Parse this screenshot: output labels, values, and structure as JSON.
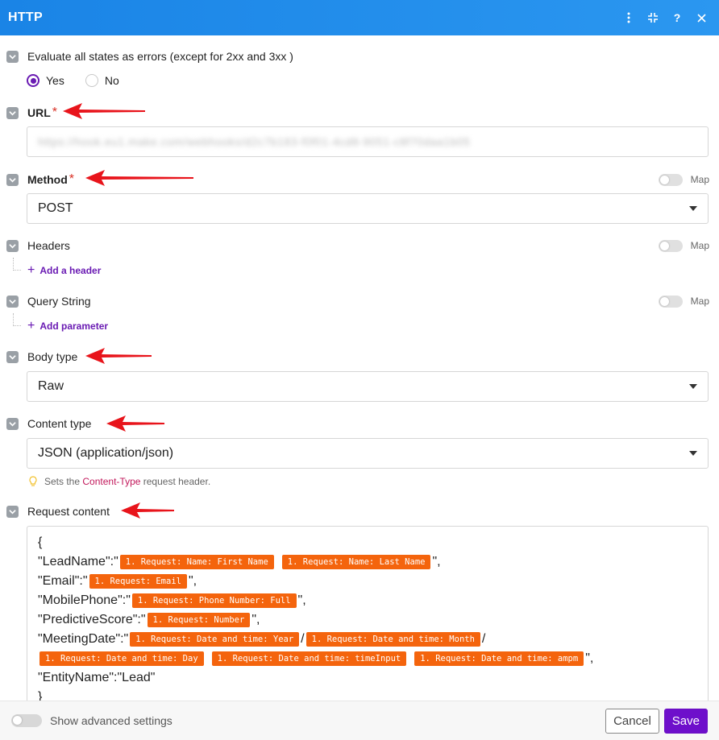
{
  "window": {
    "title": "HTTP",
    "actions": [
      {
        "name": "more-vert-icon",
        "glyph": "⋮"
      },
      {
        "name": "collapse-icon",
        "glyph": "⛶"
      },
      {
        "name": "help-icon",
        "glyph": "?"
      },
      {
        "name": "close-icon",
        "glyph": "✕"
      }
    ]
  },
  "evaluate": {
    "label": "Evaluate all states as errors (except for 2xx and 3xx )",
    "yes": "Yes",
    "no": "No",
    "selected": "Yes"
  },
  "url": {
    "label": "URL",
    "required": "*",
    "value": "https://hook.eu1.make.com/webhooks/d2c7b183-f0f01-4cd8-9051-c8f70daa1b05"
  },
  "method": {
    "label": "Method",
    "required": "*",
    "map": "Map",
    "value": "POST"
  },
  "headers": {
    "label": "Headers",
    "map": "Map",
    "add": "Add a header"
  },
  "query": {
    "label": "Query String",
    "map": "Map",
    "add": "Add parameter"
  },
  "body_type": {
    "label": "Body type",
    "value": "Raw"
  },
  "content_type": {
    "label": "Content type",
    "value": "JSON (application/json)",
    "hint_prefix": "Sets the ",
    "hint_code": "Content-Type",
    "hint_suffix": " request header."
  },
  "request_content": {
    "label": "Request content",
    "lines": {
      "open": "{",
      "lead_key": "\"LeadName\":\"",
      "lead_pill1": "1. Request: Name: First Name",
      "lead_pill2": "1. Request: Name: Last Name",
      "lead_end": "\",",
      "email_key": "\"Email\":\"",
      "email_pill": "1. Request: Email",
      "email_end": "\",",
      "phone_key": "\"MobilePhone\":\"",
      "phone_pill": "1. Request: Phone Number: Full",
      "phone_end": "\",",
      "score_key": "\"PredictiveScore\":\"",
      "score_pill": "1. Request: Number",
      "score_end": "\",",
      "meet_key": "\"MeetingDate\":\"",
      "meet_pill1": "1. Request: Date and time: Year",
      "meet_sep1": "/",
      "meet_pill2": "1. Request: Date and time: Month",
      "meet_sep2": "/",
      "meet_pill3": "1. Request: Date and time: Day",
      "meet_pill4": "1. Request: Date and time: timeInput",
      "meet_pill5": "1. Request: Date and time: ampm",
      "meet_end": "\",",
      "entity": "\"EntityName\":\"Lead\"",
      "close": "}"
    }
  },
  "footer": {
    "advanced": "Show advanced settings",
    "cancel": "Cancel",
    "save": "Save"
  },
  "colors": {
    "header": "#1a84e6",
    "accent": "#6a1bb3",
    "pill": "#f4640d",
    "annotation_arrow": "#e8141b"
  }
}
